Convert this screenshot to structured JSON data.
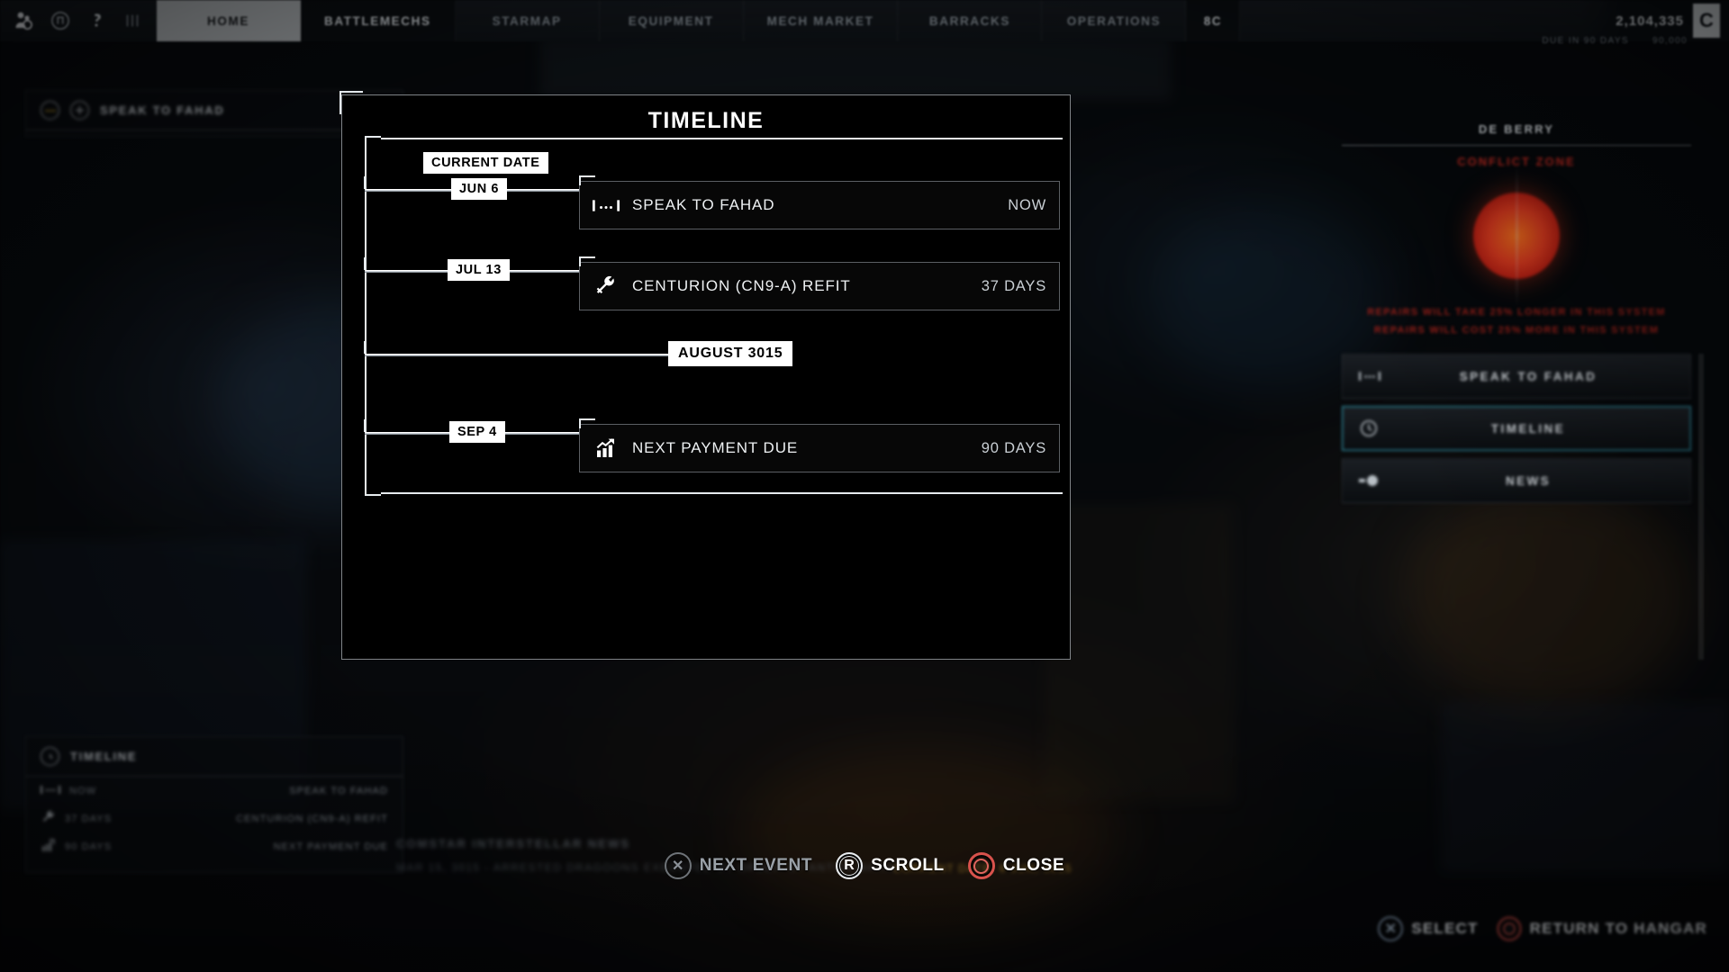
{
  "topnav": {
    "icons": [
      "pilot-icon",
      "mech-icon",
      "help-icon",
      "contract-icon"
    ],
    "tabs": [
      {
        "label": "HOME",
        "state": "active"
      },
      {
        "label": "BATTLEMECHS",
        "state": "sub"
      },
      {
        "label": "STARMAP",
        "state": "normal"
      },
      {
        "label": "EQUIPMENT",
        "state": "normal"
      },
      {
        "label": "MECH MARKET",
        "state": "normal"
      },
      {
        "label": "BARRACKS",
        "state": "normal"
      },
      {
        "label": "OPERATIONS",
        "state": "normal"
      }
    ],
    "mech_count": "8C",
    "funds": "2,104,335",
    "currency_symbol": "C",
    "sub_left": "DUE IN 90 DAYS",
    "sub_right": "90,000"
  },
  "sidebar": {
    "system_name": "DE BERRY",
    "zone_status": "CONFLICT ZONE",
    "warnings": [
      "REPAIRS WILL TAKE 25% LONGER IN THIS SYSTEM",
      "REPAIRS WILL COST 25% MORE IN THIS SYSTEM"
    ],
    "buttons": [
      {
        "label": "SPEAK TO FAHAD",
        "icon": "dialog-icon",
        "selected": false
      },
      {
        "label": "TIMELINE",
        "icon": "clock-icon",
        "selected": true
      },
      {
        "label": "NEWS",
        "icon": "news-icon",
        "selected": false
      }
    ]
  },
  "bg_widgets": {
    "speak_card": {
      "title": "SPEAK TO FAHAD",
      "icon": "dialog-icon"
    },
    "timeline_card": {
      "title": "TIMELINE",
      "icon": "clock-icon",
      "rows": [
        {
          "icon": "dialog-icon",
          "time": "NOW",
          "label": "SPEAK TO FAHAD"
        },
        {
          "icon": "wrench-icon",
          "time": "37 DAYS",
          "label": "CENTURION (CN9-A) REFIT"
        },
        {
          "icon": "finance-icon",
          "time": "90 DAYS",
          "label": "NEXT PAYMENT DUE"
        }
      ]
    }
  },
  "ticker": {
    "headline": "COMSTAR INTERSTELLAR NEWS",
    "story": "MAR 15, 3015 - ARRESTED DRAGOONS EXECUTED BY ORDER OF ANTON MARIK",
    "current_date_label": "CURRENT DATE: 6 JUN, 3015"
  },
  "modal": {
    "title": "TIMELINE",
    "current_date_chip": "CURRENT DATE",
    "markers": [
      {
        "id": "jun6",
        "text": "JUN 6",
        "kind": "day"
      },
      {
        "id": "jul13",
        "text": "JUL 13",
        "kind": "day"
      },
      {
        "id": "aug3015",
        "text": "AUGUST 3015",
        "kind": "month"
      },
      {
        "id": "sep4",
        "text": "SEP 4",
        "kind": "day"
      }
    ],
    "events": [
      {
        "icon": "dialog-icon",
        "label": "SPEAK TO FAHAD",
        "time": "NOW"
      },
      {
        "icon": "wrench-icon",
        "label": "CENTURION (CN9-A) REFIT",
        "time": "37 DAYS"
      },
      {
        "icon": "finance-icon",
        "label": "NEXT PAYMENT DUE",
        "time": "90 DAYS"
      }
    ]
  },
  "prompts": [
    {
      "button": "X",
      "label": "NEXT EVENT",
      "style": "dim"
    },
    {
      "button": "R",
      "label": "SCROLL",
      "style": "lit"
    },
    {
      "button": "O",
      "label": "CLOSE",
      "style": "lit"
    }
  ],
  "footer_prompts": [
    {
      "button": "X",
      "label": "SELECT"
    },
    {
      "button": "O",
      "label": "RETURN TO HANGAR"
    }
  ],
  "colors": {
    "accent_red": "#c0281f",
    "selected_cyan": "#2b7f91",
    "chip_bg": "#ffffff",
    "rail": "#e6ebee"
  }
}
